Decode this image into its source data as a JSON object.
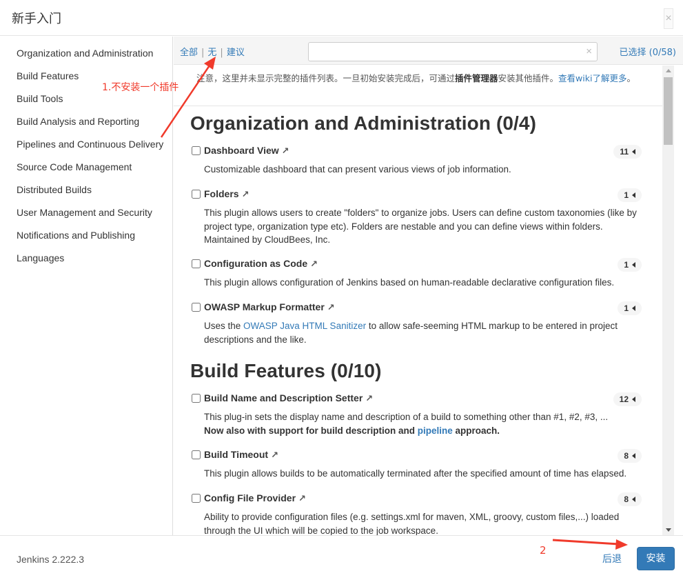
{
  "dialog": {
    "title": "新手入门",
    "close_label": "×"
  },
  "sidebar": {
    "items": [
      {
        "label": "Organization and Administration"
      },
      {
        "label": "Build Features"
      },
      {
        "label": "Build Tools"
      },
      {
        "label": "Build Analysis and Reporting"
      },
      {
        "label": "Pipelines and Continuous Delivery"
      },
      {
        "label": "Source Code Management"
      },
      {
        "label": "Distributed Builds"
      },
      {
        "label": "User Management and Security"
      },
      {
        "label": "Notifications and Publishing"
      },
      {
        "label": "Languages"
      }
    ]
  },
  "toolbar": {
    "filter_all": "全部",
    "filter_none": "无",
    "filter_suggested": "建议",
    "separator": "|",
    "search_value": "",
    "search_clear": "×",
    "selected_count": "已选择 (0/58)"
  },
  "notice": {
    "text": "注意，这里并未显示完整的插件列表。一旦初始安装完成后，可通过",
    "bold": "插件管理器",
    "text2": "安装其他插件。",
    "link": "查看wiki了解更多",
    "end": "。"
  },
  "categories": [
    {
      "title": "Organization and Administration (0/4)",
      "plugins": [
        {
          "name": "Dashboard View",
          "count": "11",
          "desc": "Customizable dashboard that can present various views of job information."
        },
        {
          "name": "Folders",
          "count": "1",
          "desc": "This plugin allows users to create \"folders\" to organize jobs. Users can define custom taxonomies (like by project type, organization type etc). Folders are nestable and you can define views within folders. Maintained by CloudBees, Inc."
        },
        {
          "name": "Configuration as Code",
          "count": "1",
          "desc": "This plugin allows configuration of Jenkins based on human-readable declarative configuration files."
        },
        {
          "name": "OWASP Markup Formatter",
          "count": "1",
          "desc_pre": "Uses the ",
          "desc_link": "OWASP Java HTML Sanitizer",
          "desc_post": " to allow safe-seeming HTML markup to be entered in project descriptions and the like."
        }
      ]
    },
    {
      "title": "Build Features (0/10)",
      "plugins": [
        {
          "name": "Build Name and Description Setter",
          "count": "12",
          "desc": "This plug-in sets the display name and description of a build to something other than #1, #2, #3, ...",
          "desc_strong_pre": "Now also with support for build description and ",
          "desc_strong_link": "pipeline",
          "desc_strong_post": " approach."
        },
        {
          "name": "Build Timeout",
          "count": "8",
          "desc": "This plugin allows builds to be automatically terminated after the specified amount of time has elapsed."
        },
        {
          "name": "Config File Provider",
          "count": "8",
          "desc": "Ability to provide configuration files (e.g. settings.xml for maven, XML, groovy, custom files,...) loaded through the UI which will be copied to the job workspace."
        }
      ]
    }
  ],
  "external_glyph": "↗",
  "footer": {
    "version": "Jenkins 2.222.3",
    "back_label": "后退",
    "install_label": "安装"
  },
  "annotations": {
    "note_1": "1.不安装一个插件",
    "note_2": "2",
    "color": "#f03a2b"
  },
  "colors": {
    "link": "#337ab7",
    "primary_button": "#337ab7"
  }
}
